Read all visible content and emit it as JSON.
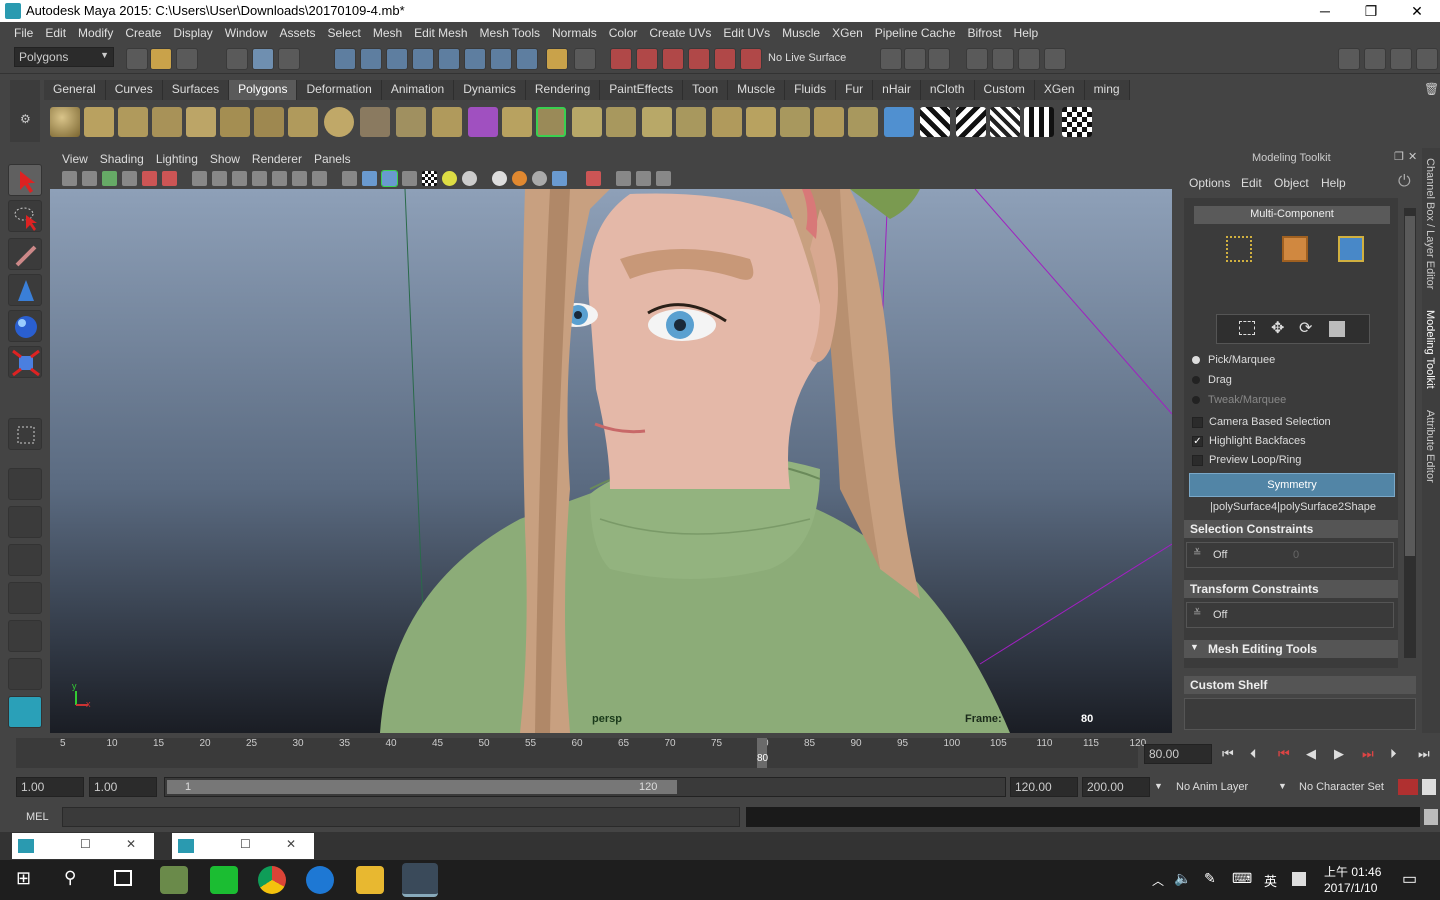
{
  "window": {
    "title": "Autodesk Maya 2015: C:\\Users\\User\\Downloads\\20170109-4.mb*",
    "min": "─",
    "max": "❐",
    "close": "✕"
  },
  "menubar": [
    "File",
    "Edit",
    "Modify",
    "Create",
    "Display",
    "Window",
    "Assets",
    "Select",
    "Mesh",
    "Edit Mesh",
    "Mesh Tools",
    "Normals",
    "Color",
    "Create UVs",
    "Edit UVs",
    "Muscle",
    "XGen",
    "Pipeline Cache",
    "Bifrost",
    "Help"
  ],
  "statusline": {
    "mode": "Polygons",
    "live_surface": "No Live Surface"
  },
  "shelf": {
    "tabs": [
      "General",
      "Curves",
      "Surfaces",
      "Polygons",
      "Deformation",
      "Animation",
      "Dynamics",
      "Rendering",
      "PaintEffects",
      "Toon",
      "Muscle",
      "Fluids",
      "Fur",
      "nHair",
      "nCloth",
      "Custom",
      "XGen",
      "ming"
    ],
    "active": "Polygons"
  },
  "viewport": {
    "menus": [
      "View",
      "Shading",
      "Lighting",
      "Show",
      "Renderer",
      "Panels"
    ],
    "camera": "persp",
    "frame_label": "Frame:",
    "frame_value": "80",
    "axis_x": "x",
    "axis_y": "y"
  },
  "modeling_toolkit": {
    "title": "Modeling Toolkit",
    "menus": [
      "Options",
      "Edit",
      "Object",
      "Help"
    ],
    "multi_component": "Multi-Component",
    "pick": [
      "Pick/Marquee",
      "Drag",
      "Tweak/Marquee"
    ],
    "checks": [
      {
        "label": "Camera Based Selection",
        "checked": false
      },
      {
        "label": "Highlight Backfaces",
        "checked": true
      },
      {
        "label": "Preview Loop/Ring",
        "checked": false
      }
    ],
    "symmetry": "Symmetry",
    "shape": "|polySurface4|polySurface2Shape",
    "selection_constraints": "Selection Constraints",
    "sel_value": "Off",
    "sel_num": "0",
    "transform_constraints": "Transform Constraints",
    "tr_value": "Off",
    "mesh_editing_tools": "Mesh Editing Tools",
    "custom_shelf": "Custom Shelf"
  },
  "side_tabs": [
    "Channel Box / Layer Editor",
    "Modeling Toolkit",
    "Attribute Editor"
  ],
  "timeslider": {
    "ticks": [
      "5",
      "10",
      "15",
      "20",
      "25",
      "30",
      "35",
      "40",
      "45",
      "50",
      "55",
      "60",
      "65",
      "70",
      "75",
      "80",
      "85",
      "90",
      "95",
      "100",
      "105",
      "110",
      "115",
      "120"
    ],
    "current": "80",
    "current_field": "80.00"
  },
  "range": {
    "start1": "1.00",
    "start2": "1.00",
    "slider_start": "1",
    "slider_end": "120",
    "end1": "120.00",
    "end2": "200.00",
    "anim_layer": "No Anim Layer",
    "char_set": "No Character Set"
  },
  "cmd": {
    "label": "MEL"
  },
  "taskbar": {
    "time": "上午 01:46",
    "date": "2017/1/10",
    "ime": "英"
  },
  "colors": {
    "accent": "#5285a6",
    "panel": "#444444",
    "dark": "#2b2b2b",
    "sweater": "#8cac78",
    "skin": "#e4b8a8",
    "hair": "#c8a080"
  }
}
